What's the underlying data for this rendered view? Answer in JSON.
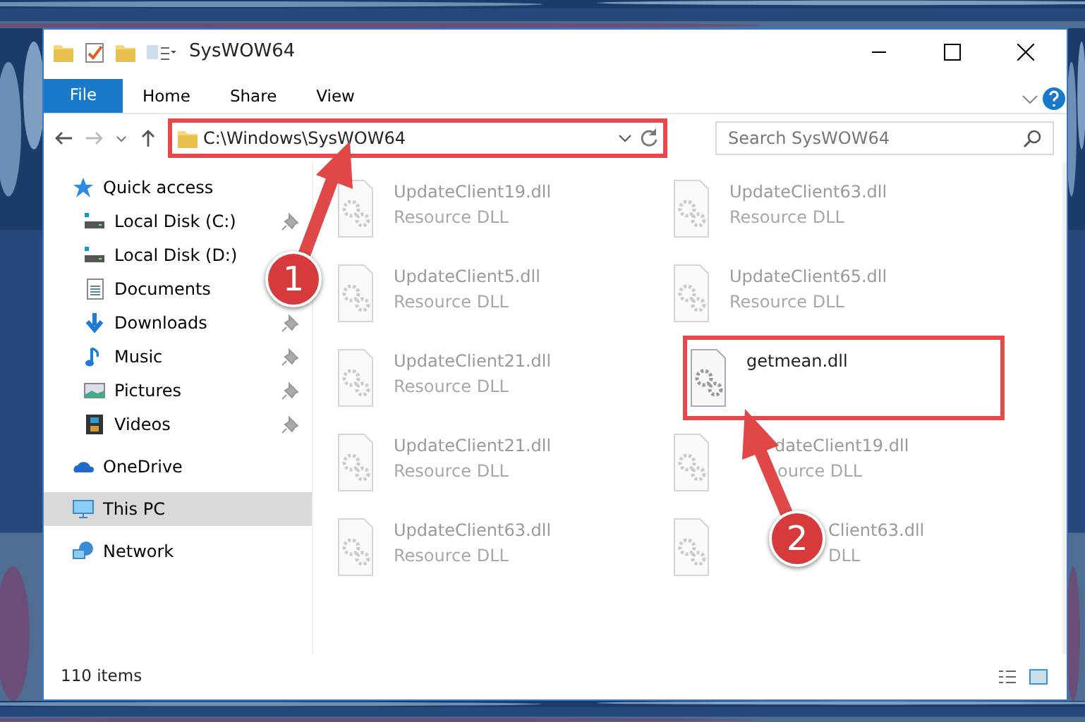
{
  "window": {
    "title": "SysWOW64"
  },
  "ribbon_tabs": [
    {
      "label": "File",
      "kind": "file"
    },
    {
      "label": "Home",
      "kind": "tab"
    },
    {
      "label": "Share",
      "kind": "tab"
    },
    {
      "label": "View",
      "kind": "tab"
    }
  ],
  "address": {
    "path": "C:\\Windows\\SysWOW64",
    "highlighted": true,
    "search_placeholder": "Search SysWOW64"
  },
  "sidebar": {
    "items": [
      {
        "label": "Quick access",
        "kind": "star",
        "selected": false,
        "children": [
          {
            "label": "Local Disk (C:)",
            "kind": "disk",
            "pinned": true,
            "selected": false
          },
          {
            "label": "Local Disk (D:)",
            "kind": "disk",
            "pinned": false,
            "selected": false
          },
          {
            "label": "Documents",
            "kind": "doc",
            "pinned": false,
            "selected": false
          },
          {
            "label": "Downloads",
            "kind": "download",
            "pinned": true,
            "selected": false
          },
          {
            "label": "Music",
            "kind": "music",
            "pinned": true,
            "selected": false
          },
          {
            "label": "Pictures",
            "kind": "pictures",
            "pinned": true,
            "selected": false
          },
          {
            "label": "Videos",
            "kind": "videos",
            "pinned": true,
            "selected": false
          }
        ]
      },
      {
        "label": "OneDrive",
        "kind": "cloud",
        "selected": false
      },
      {
        "label": "This PC",
        "kind": "pc",
        "selected": true
      },
      {
        "label": "Network",
        "kind": "network",
        "selected": false
      }
    ]
  },
  "files": [
    {
      "kind": "whole",
      "name": "UpdateClient19.dll",
      "type": "Resource DLL",
      "highlighted": false
    },
    {
      "kind": "whole",
      "name": "UpdateClient63.dll",
      "type": "Resource DLL",
      "highlighted": false
    },
    {
      "kind": "whole",
      "name": "UpdateClient5.dll",
      "type": "Resource DLL",
      "highlighted": false
    },
    {
      "kind": "whole",
      "name": "UpdateClient65.dll",
      "type": "Resource DLL",
      "highlighted": false
    },
    {
      "kind": "whole",
      "name": "UpdateClient21.dll",
      "type": "Resource DLL",
      "highlighted": false
    },
    {
      "kind": "whole",
      "name": "getmean.dll",
      "highlighted": true
    },
    {
      "kind": "whole",
      "name": "UpdateClient21.dll",
      "type": "Resource DLL",
      "highlighted": false
    },
    {
      "kind": "under_arrow",
      "name": "dateClient19.dll",
      "type": "ource DLL",
      "highlighted": false
    },
    {
      "kind": "whole",
      "name": "UpdateClient63.dll",
      "type": "Resource DLL",
      "highlighted": false
    },
    {
      "kind": "under_badge",
      "name": "Client63.dll",
      "type": "DLL",
      "highlighted": false
    }
  ],
  "status_bar": {
    "count": "110 items"
  },
  "annotations": [
    {
      "label": "1"
    },
    {
      "label": "2"
    }
  ]
}
